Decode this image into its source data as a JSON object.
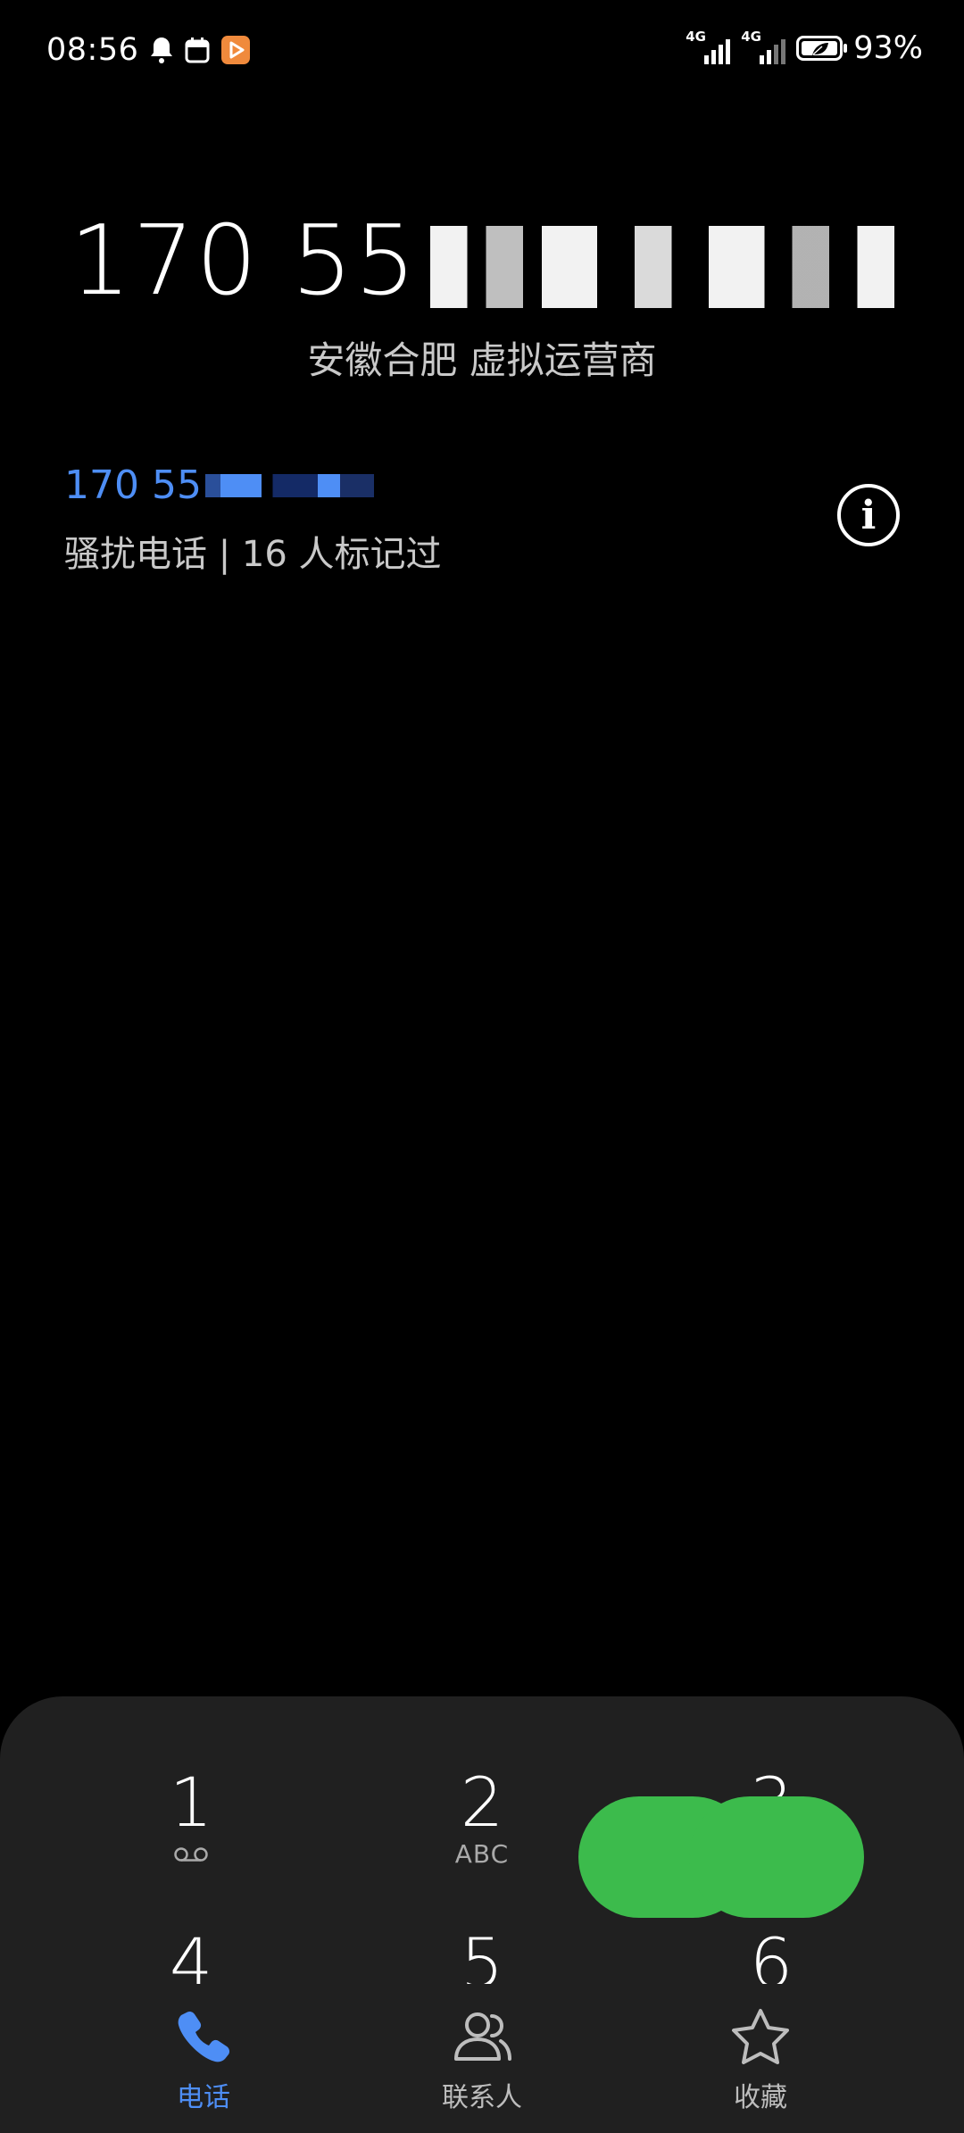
{
  "status_bar": {
    "time": "08:56",
    "network_1": "4G",
    "network_2": "4G",
    "battery": "93%"
  },
  "caller": {
    "number_prefix": "170 55",
    "location": "安徽合肥 虚拟运营商"
  },
  "recent": {
    "number_prefix": "170 55",
    "tag": "骚扰电话 | 16 人标记过",
    "info_symbol": "i"
  },
  "dialpad": {
    "keys": [
      {
        "num": "1",
        "sub": "voicemail"
      },
      {
        "num": "2",
        "sub": "ABC"
      },
      {
        "num": "3",
        "sub": ""
      },
      {
        "num": "4",
        "sub": ""
      },
      {
        "num": "5",
        "sub": ""
      },
      {
        "num": "6",
        "sub": ""
      }
    ]
  },
  "bottom_nav": {
    "items": [
      {
        "label": "电话",
        "icon": "phone-icon",
        "active": true
      },
      {
        "label": "联系人",
        "icon": "contacts-icon",
        "active": false
      },
      {
        "label": "收藏",
        "icon": "star-icon",
        "active": false
      }
    ]
  },
  "colors": {
    "accent_blue": "#4e8ef5",
    "call_green": "#3cbb4c",
    "panel_bg": "#202020"
  }
}
